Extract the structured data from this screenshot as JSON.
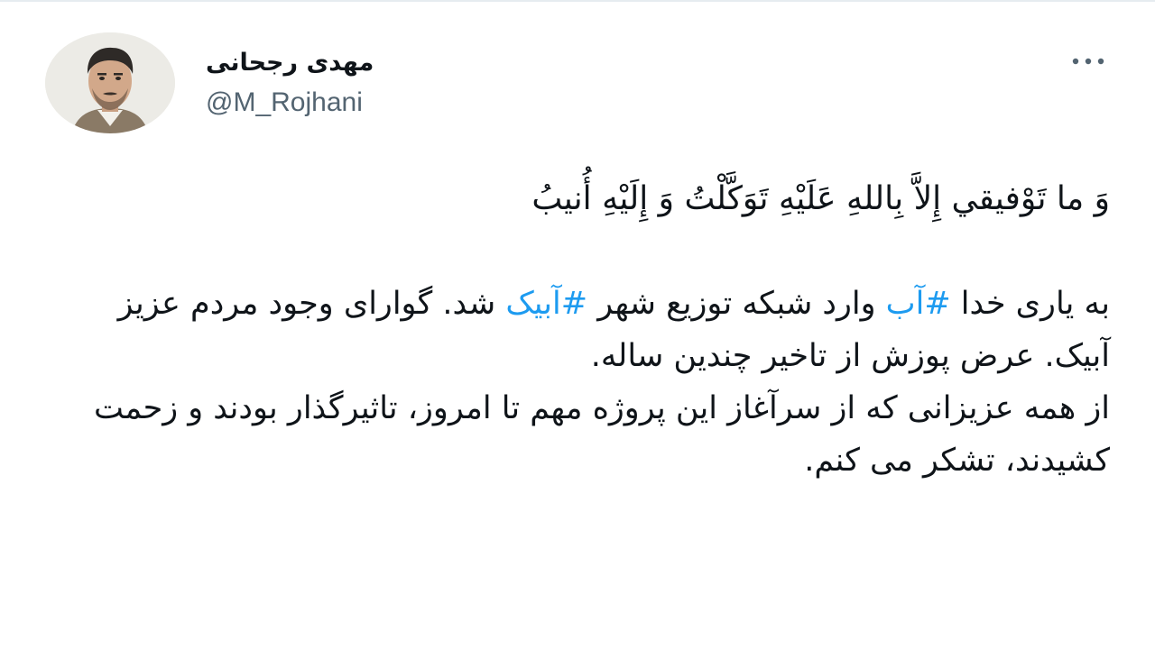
{
  "author": {
    "name": "مهدی رجحانی",
    "handle": "@M_Rojhani"
  },
  "menu": {
    "icon": "more-horizontal-icon"
  },
  "tweet": {
    "verse": "وَ ما تَوْفيقي إِلاَّ بِاللهِ عَلَيْهِ تَوَكَّلْتُ وَ إِلَيْهِ أُنيبُ",
    "p1_a": "به یاری خدا ",
    "hashtag_1": "#آب",
    "p1_b": " وارد شبکه توزیع شهر ",
    "hashtag_2": "#آبیک",
    "p1_c": " شد. گوارای وجود مردم عزیز آبیک. عرض پوزش از تاخیر چندین ساله.",
    "p2": "از همه عزیزانی که از سرآغاز این پروژه مهم تا امروز، تاثیرگذار بودند و زحمت کشیدند، تشکر می کنم."
  },
  "colors": {
    "hashtag": "#1d9bf0",
    "text": "#0f1419",
    "secondary": "#536471"
  }
}
